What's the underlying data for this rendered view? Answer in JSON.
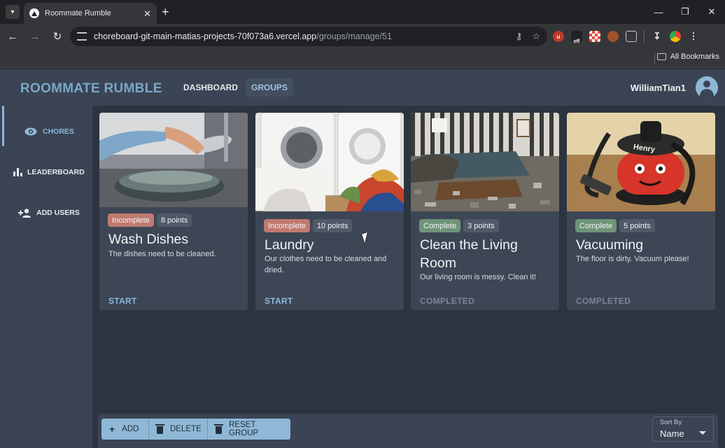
{
  "browser": {
    "tab_title": "Roommate Rumble",
    "url_host": "choreboard-git-main-matias-projects-70f073a6.vercel.app",
    "url_path": "/groups/manage/51",
    "all_bookmarks": "All Bookmarks",
    "extension_badge": "off"
  },
  "header": {
    "brand": "ROOMMATE RUMBLE",
    "nav": {
      "dashboard": "DASHBOARD",
      "groups": "GROUPS"
    },
    "username": "WilliamTian1"
  },
  "sidebar": {
    "items": [
      {
        "label": "CHORES",
        "icon": "eye-icon",
        "active": true
      },
      {
        "label": "LEADERBOARD",
        "icon": "bar-chart-icon",
        "active": false
      },
      {
        "label": "ADD USERS",
        "icon": "person-add-icon",
        "active": false
      }
    ]
  },
  "chores": [
    {
      "status": "Incomplete",
      "points": "8 points",
      "title": "Wash Dishes",
      "description": "The dishes need to be cleaned.",
      "action": "START",
      "image": "dishes-photo"
    },
    {
      "status": "Incomplete",
      "points": "10 points",
      "title": "Laundry",
      "description": "Our clothes need to be cleaned and dried.",
      "action": "START",
      "image": "laundry-photo"
    },
    {
      "status": "Complete",
      "points": "3 points",
      "title": "Clean the Living Room",
      "description": "Our living room is messy. Clean it!",
      "action": "COMPLETED",
      "image": "living-room-photo"
    },
    {
      "status": "Complete",
      "points": "5 points",
      "title": "Vacuuming",
      "description": "The floor is dirty. Vacuum please!",
      "action": "COMPLETED",
      "image": "vacuum-photo",
      "image_text": "Henry"
    }
  ],
  "actions": {
    "add": "ADD",
    "delete": "DELETE",
    "reset": "RESET GROUP"
  },
  "sort": {
    "label": "Sort By",
    "value": "Name"
  },
  "colors": {
    "accent": "#8fb8d6",
    "incomplete": "#c07a70",
    "complete": "#6f9478",
    "background": "#2c3440"
  }
}
